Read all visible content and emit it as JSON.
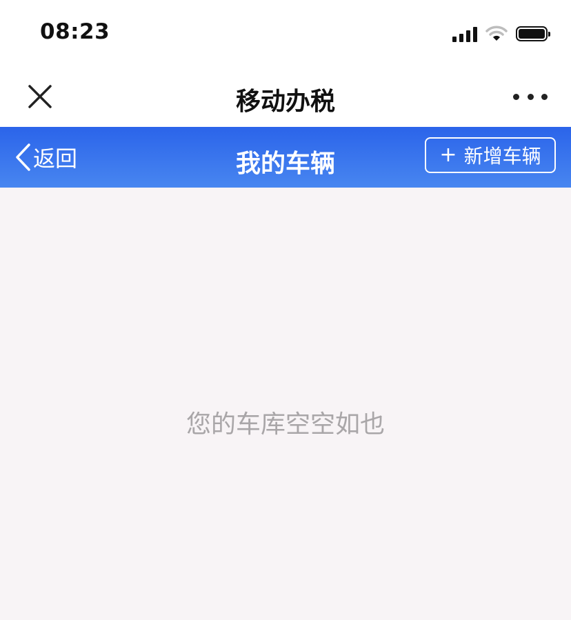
{
  "status_bar": {
    "time": "08:23",
    "icons": [
      "cellular-signal-icon",
      "wifi-icon",
      "battery-icon"
    ]
  },
  "top_bar": {
    "title": "移动办税",
    "close_icon": "close-icon",
    "more_icon": "more-dots-icon"
  },
  "header": {
    "back_label": "返回",
    "title": "我的车辆",
    "add_plus": "+",
    "add_label": "新增车辆",
    "gradient_top": "#2b64ea",
    "gradient_bottom": "#4886f0"
  },
  "main": {
    "empty_message": "您的车库空空如也",
    "background": "#f8f4f6"
  }
}
